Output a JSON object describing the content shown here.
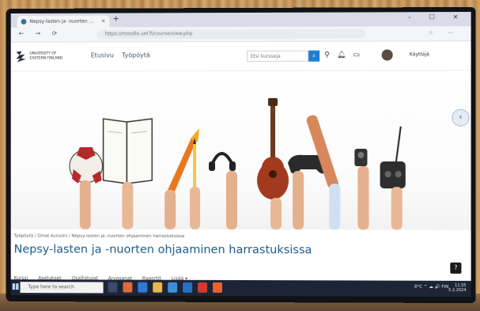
{
  "browser": {
    "tab_title": "Nepsy-lasten ja -nuorten ...",
    "tab_close": "×",
    "new_tab": "+",
    "window_controls": "– ☐ ✕",
    "nav_buttons": "← → ⟳",
    "url": "https://moodle.uef.fi/course/view.php",
    "toolbar_icons": "☆ ⋯"
  },
  "site": {
    "logo_text": "UNIVERSITY OF EASTERN FINLAND",
    "nav": [
      "Etusivu",
      "Työpöytä"
    ],
    "search_placeholder": "Etsi kursseja",
    "search_icon": "search-icon",
    "header_icons": [
      "search-icon",
      "bell-icon",
      "chat-icon"
    ],
    "user_name": "Käyttäjä"
  },
  "page": {
    "breadcrumb": "Työpöytä / Omat kurssini / Nepsy-lasten ja -nuorten ohjaaminen harrastuksissa",
    "title": "Nepsy-lasten ja -nuorten ohjaaminen harrastuksissa",
    "help": "?",
    "drawer_toggle": "‹",
    "tabs": [
      "Kurssi",
      "Asetukset",
      "Osallistujat",
      "Arvosanat",
      "Raportit",
      "Lisää ▾"
    ]
  },
  "hero": {
    "objects": [
      "football",
      "open-book",
      "paintbrush",
      "pencil",
      "headphones",
      "ukulele",
      "game-controller",
      "rolling-pin",
      "camera",
      "remote-control"
    ]
  },
  "taskbar": {
    "search_placeholder": "Type here to search",
    "tray_text": "8°C ^ ☁ 🔊 FIN",
    "time": "11.55",
    "date": "5.2.2024"
  },
  "colors": {
    "title": "#1a5a8a",
    "accent": "#1f7fd0",
    "taskbar": "#1d2436"
  }
}
